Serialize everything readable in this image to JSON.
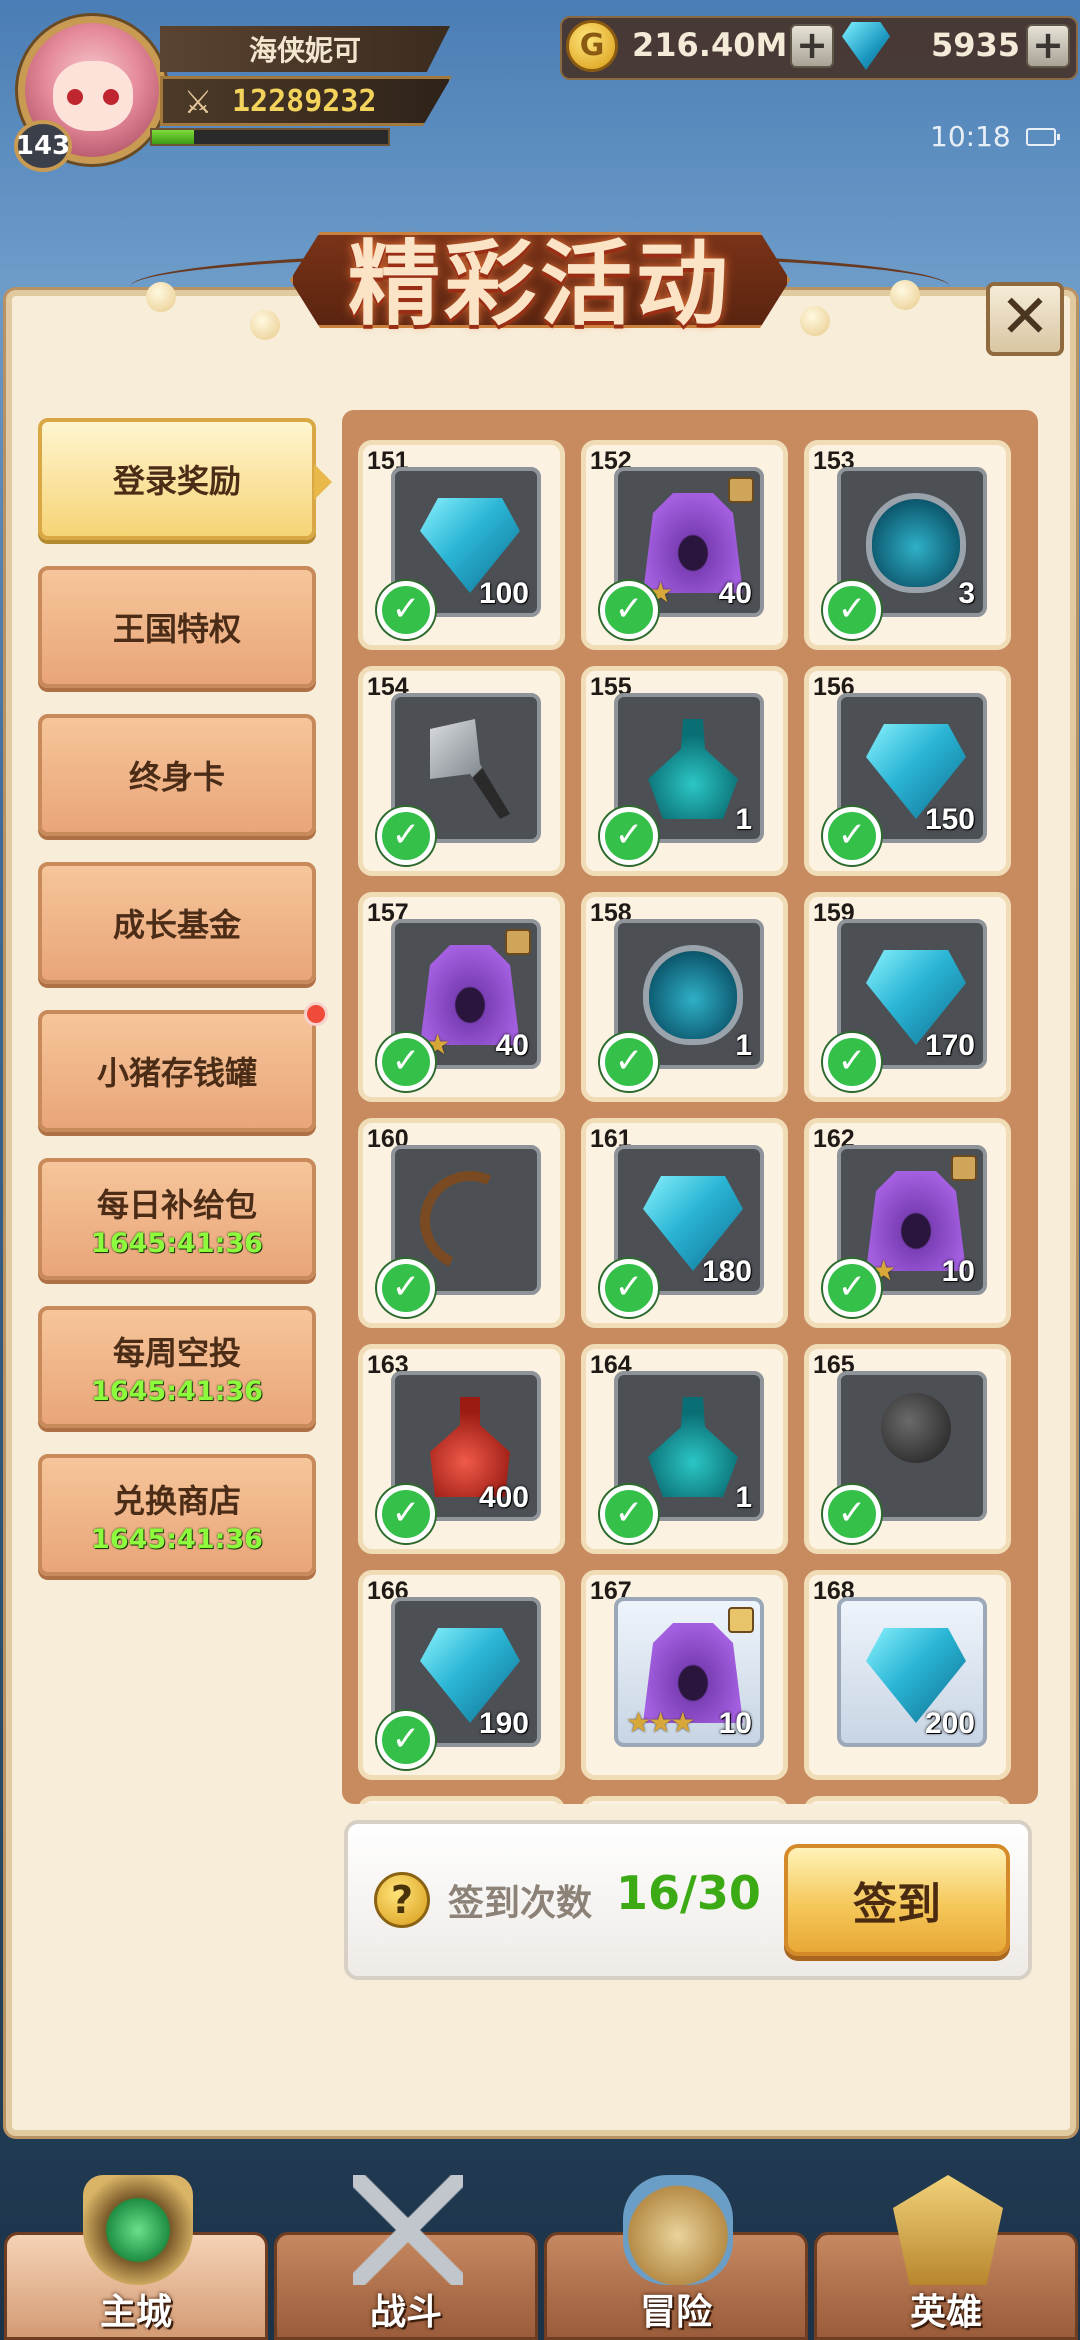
{
  "player": {
    "name": "海侠妮可",
    "level": "143",
    "power": "12289232",
    "xp_fraction": 0.18
  },
  "resources": {
    "gold": "216.40M",
    "gems": "5935",
    "plus_symbol": "+"
  },
  "status_bar": {
    "time": "10:18"
  },
  "title": "精彩活动",
  "close_symbol": "✕",
  "tabs": [
    {
      "label": "登录奖励",
      "active": true
    },
    {
      "label": "王国特权"
    },
    {
      "label": "终身卡"
    },
    {
      "label": "成长基金"
    },
    {
      "label": "小猪存钱罐",
      "badge": true
    },
    {
      "label": "每日补给包",
      "timer": "1645:41:36"
    },
    {
      "label": "每周空投",
      "timer": "1645:41:36"
    },
    {
      "label": "兑换商店",
      "timer": "1645:41:36"
    }
  ],
  "rewards": [
    {
      "day": "151",
      "icon": "gem-icon",
      "qty": "100",
      "stars": "",
      "claimed": true
    },
    {
      "day": "152",
      "icon": "hood-icon",
      "qty": "40",
      "stars": "★★",
      "claimed": true,
      "fragment": true
    },
    {
      "day": "153",
      "icon": "egg-icon",
      "qty": "3",
      "stars": "",
      "claimed": true
    },
    {
      "day": "154",
      "icon": "axe-icon",
      "qty": "",
      "stars": "★",
      "claimed": true
    },
    {
      "day": "155",
      "icon": "flask-icon",
      "qty": "1",
      "stars": "",
      "claimed": true
    },
    {
      "day": "156",
      "icon": "gem-icon",
      "qty": "150",
      "stars": "",
      "claimed": true
    },
    {
      "day": "157",
      "icon": "hood-icon",
      "qty": "40",
      "stars": "★★",
      "claimed": true,
      "fragment": true
    },
    {
      "day": "158",
      "icon": "egg-icon",
      "qty": "1",
      "stars": "",
      "claimed": true
    },
    {
      "day": "159",
      "icon": "gem-icon",
      "qty": "170",
      "stars": "",
      "claimed": true
    },
    {
      "day": "160",
      "icon": "bow-icon",
      "qty": "",
      "stars": "★",
      "claimed": true
    },
    {
      "day": "161",
      "icon": "gem-icon",
      "qty": "180",
      "stars": "",
      "claimed": true
    },
    {
      "day": "162",
      "icon": "hood-icon",
      "qty": "10",
      "stars": "★★",
      "claimed": true,
      "fragment": true
    },
    {
      "day": "163",
      "icon": "potion-icon",
      "qty": "400",
      "stars": "",
      "claimed": true
    },
    {
      "day": "164",
      "icon": "flask-icon",
      "qty": "1",
      "stars": "",
      "claimed": true
    },
    {
      "day": "165",
      "icon": "mace-icon",
      "qty": "",
      "stars": "★",
      "claimed": true
    },
    {
      "day": "166",
      "icon": "gem-icon",
      "qty": "190",
      "stars": "",
      "claimed": true
    },
    {
      "day": "167",
      "icon": "hood-icon",
      "qty": "10",
      "stars": "★★★",
      "claimed": false,
      "fragment": true,
      "bright": true
    },
    {
      "day": "168",
      "icon": "gem-icon",
      "qty": "200",
      "stars": "",
      "claimed": false,
      "bright": true
    }
  ],
  "check_symbol": "✓",
  "signin": {
    "label": "签到次数",
    "count": "16/30",
    "button": "签到",
    "help_symbol": "?"
  },
  "nav": [
    {
      "label": "主城",
      "icon": "castle-icon",
      "active": true
    },
    {
      "label": "战斗",
      "icon": "crossed-swords-icon"
    },
    {
      "label": "冒险",
      "icon": "adventure-icon"
    },
    {
      "label": "英雄",
      "icon": "hero-helmet-icon"
    }
  ],
  "colors": {
    "accent_green": "#3caa14",
    "timer_green": "#8dfc3c",
    "tab_active": "#f6d476",
    "tab_inactive": "#e9a579"
  }
}
